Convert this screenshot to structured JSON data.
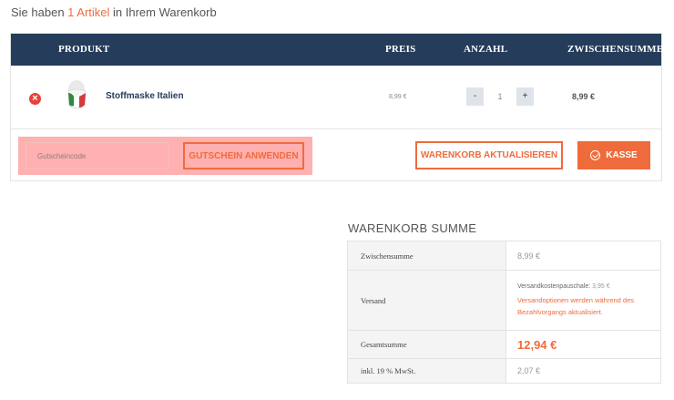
{
  "intro": {
    "prefix": "Sie haben ",
    "count": "1 Artikel",
    "suffix": " in Ihrem Warenkorb"
  },
  "table": {
    "headers": {
      "product": "PRODUKT",
      "price": "PREIS",
      "quantity": "ANZAHL",
      "subtotal": "ZWISCHENSUMME"
    },
    "items": [
      {
        "name": "Stoffmaske Italien",
        "price": "8,99 €",
        "quantity": "1",
        "subtotal": "8,99 €",
        "remove_icon": "remove-icon"
      }
    ],
    "qty_minus": "-",
    "qty_plus": "+"
  },
  "coupon": {
    "placeholder": "Gutscheincode",
    "apply_label": "GUTSCHEIN ANWENDEN"
  },
  "actions": {
    "update_label": "WARENKORB AKTUALISIEREN",
    "checkout_label": "KASSE",
    "checkout_icon": "check-circle-icon"
  },
  "totals": {
    "title": "WARENKORB SUMME",
    "subtotal_label": "Zwischensumme",
    "subtotal_value": "8,99 €",
    "shipping_label": "Versand",
    "shipping_method": "Versandkostenpauschale: ",
    "shipping_cost": "3,95 €",
    "shipping_note": "Versandoptionen werden während des Bezahlvorgangs aktualisiert.",
    "total_label": "Gesamtsumme",
    "total_value": "12,94 €",
    "tax_label": "inkl. 19 % MwSt.",
    "tax_value": "2,07 €"
  },
  "colors": {
    "accent": "#f06b3b",
    "header": "#253d5a",
    "coupon_highlight": "#ffb0b0",
    "remove": "#e8413b"
  }
}
